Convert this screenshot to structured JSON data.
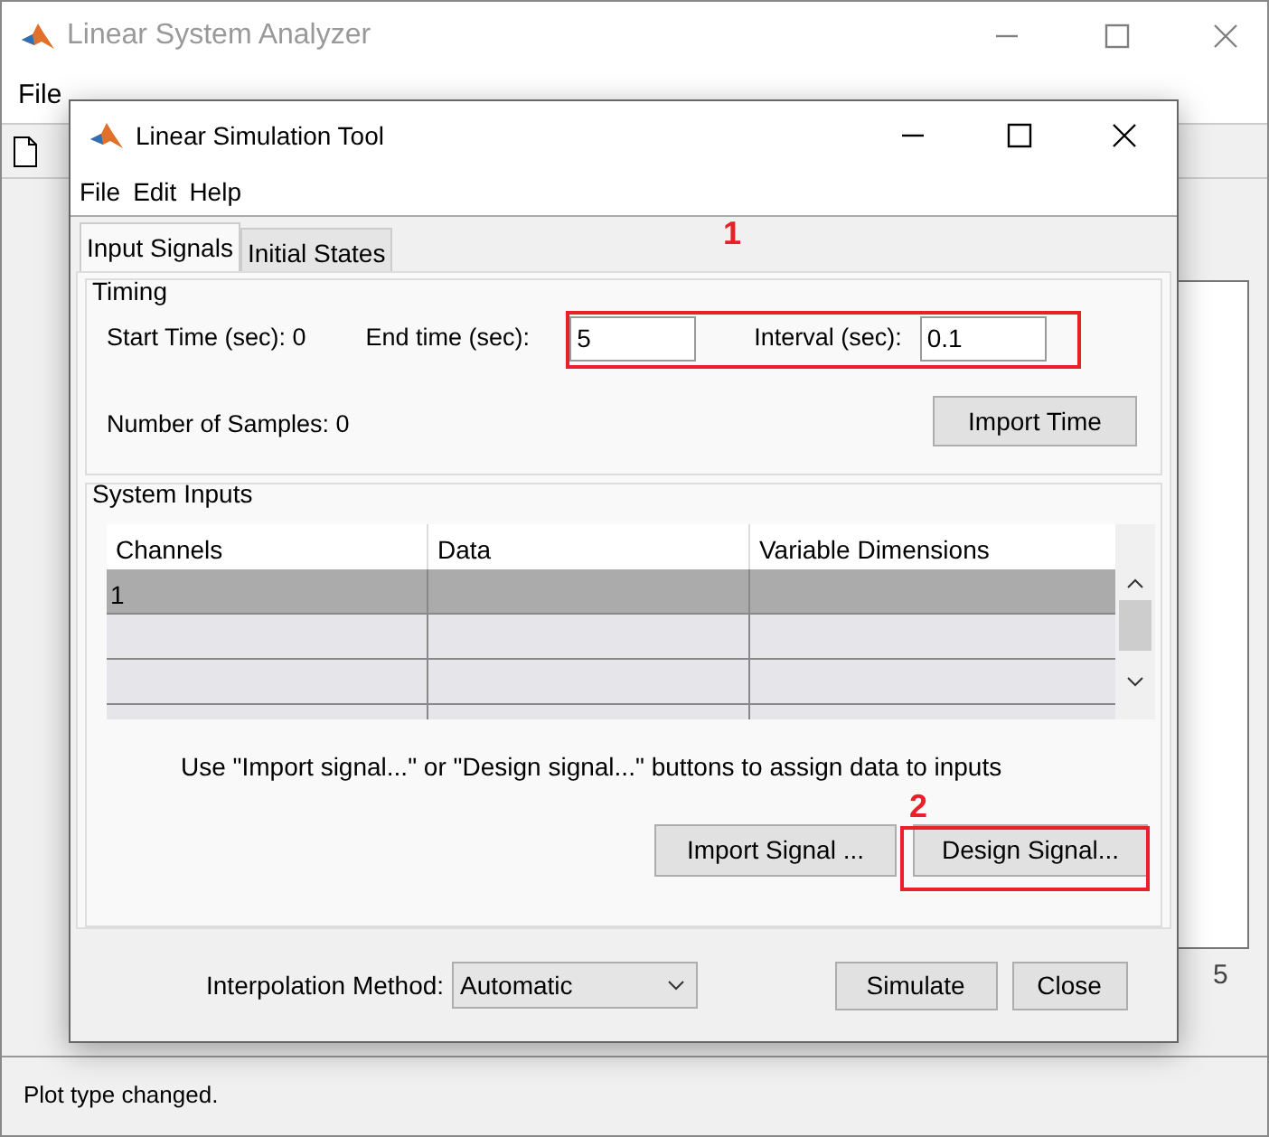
{
  "main_window": {
    "title": "Linear System Analyzer",
    "menu": [
      "File"
    ],
    "axis_tick": "5"
  },
  "dialog": {
    "title": "Linear Simulation Tool",
    "menu": [
      "File",
      "Edit",
      "Help"
    ],
    "tabs": [
      {
        "label": "Input Signals",
        "selected": true
      },
      {
        "label": "Initial States",
        "selected": false
      }
    ],
    "timing": {
      "title": "Timing",
      "start_time": "Start Time (sec): 0",
      "end_time_label": "End time (sec):",
      "end_time_value": "5",
      "interval_label": "Interval (sec):",
      "interval_value": "0.1",
      "samples": "Number of Samples: 0",
      "import_time_button": "Import Time"
    },
    "system_inputs": {
      "title": "System Inputs",
      "columns": [
        "Channels",
        "Data",
        "Variable Dimensions"
      ],
      "rows": [
        {
          "channel": "1",
          "selected": true
        },
        {
          "selected": false
        },
        {
          "selected": false
        },
        {
          "selected": false
        }
      ],
      "hint": "Use \"Import signal...\" or \"Design signal...\" buttons to assign data to inputs",
      "buttons": [
        "Import Signal ...",
        "Design Signal..."
      ]
    },
    "interpolation_label": "Interpolation Method:",
    "interpolation_value": "Automatic",
    "buttons": [
      "Simulate",
      "Close"
    ]
  },
  "annotations": [
    {
      "kind": "number",
      "text": "1"
    },
    {
      "kind": "frame"
    },
    {
      "kind": "number",
      "text": "2"
    },
    {
      "kind": "frame"
    }
  ],
  "status_bar": "Plot type changed."
}
